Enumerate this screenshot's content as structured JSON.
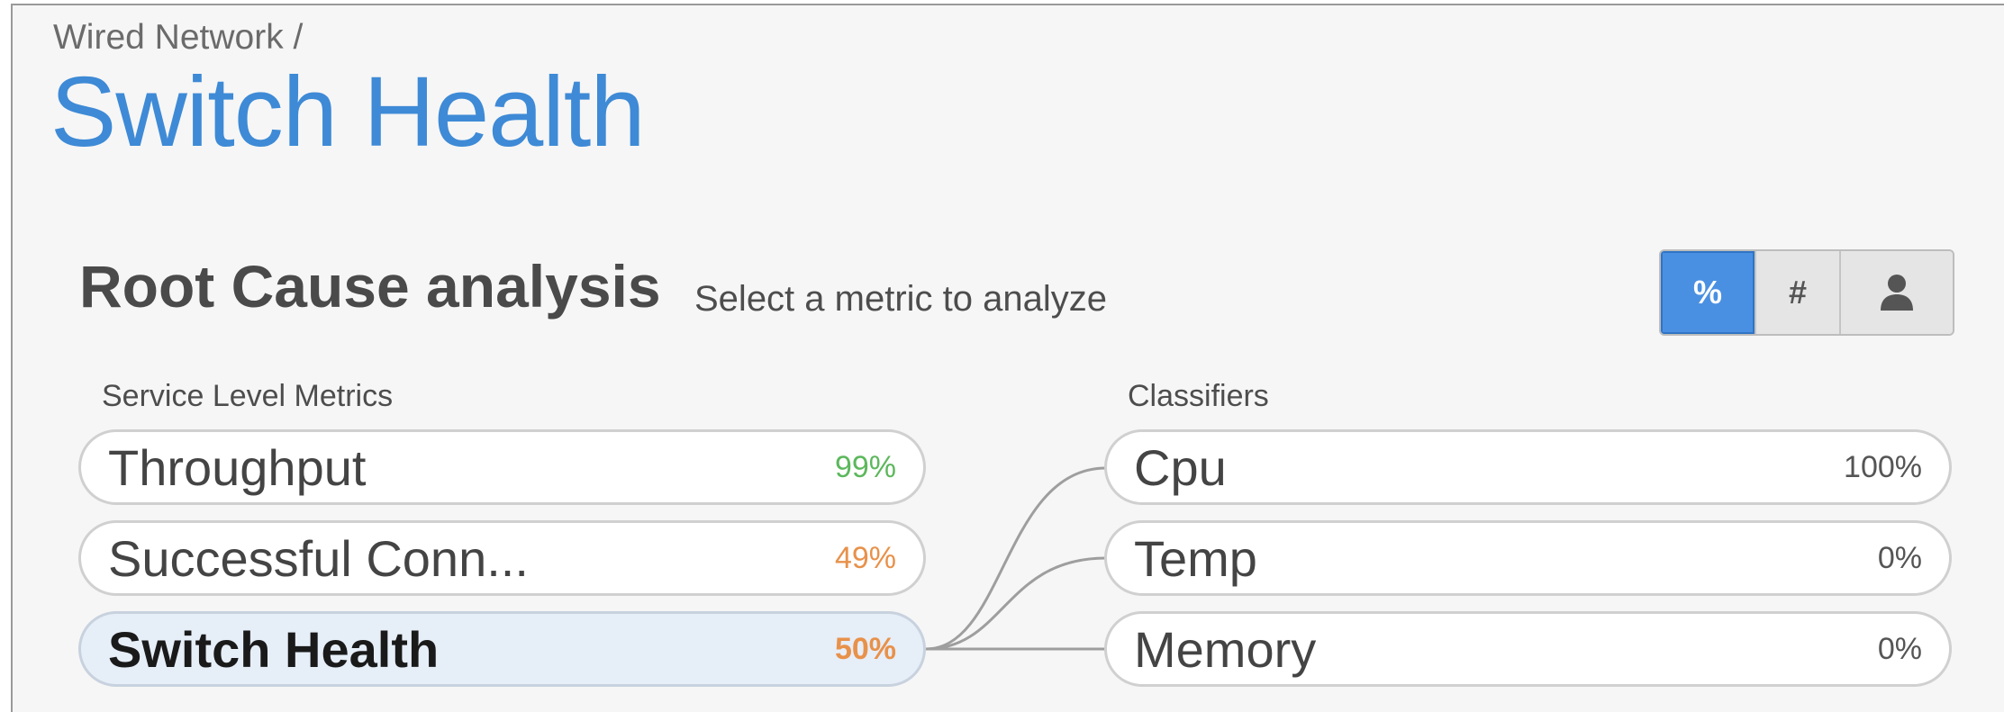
{
  "breadcrumb": "Wired Network /",
  "title": "Switch Health",
  "section": {
    "title": "Root Cause analysis",
    "subtitle": "Select a metric to analyze"
  },
  "view_toggle": {
    "options": [
      {
        "label": "%",
        "active": true
      },
      {
        "label": "#",
        "active": false
      },
      {
        "label": "",
        "icon": "person-icon",
        "active": false
      }
    ]
  },
  "service_level_metrics": {
    "label": "Service Level Metrics",
    "items": [
      {
        "name": "Throughput",
        "value": "99%",
        "color": "#5cb85c"
      },
      {
        "name": "Successful Conn...",
        "value": "49%",
        "color": "#e8914a"
      },
      {
        "name": "Switch Health",
        "value": "50%",
        "color": "#e8914a",
        "selected": true
      }
    ]
  },
  "classifiers": {
    "label": "Classifiers",
    "items": [
      {
        "name": "Cpu",
        "value": "100%"
      },
      {
        "name": "Temp",
        "value": "0%"
      },
      {
        "name": "Memory",
        "value": "0%"
      }
    ]
  },
  "colors": {
    "accent": "#4a90e2",
    "title": "#3e8ad6",
    "good": "#5cb85c",
    "warning": "#e8914a"
  }
}
